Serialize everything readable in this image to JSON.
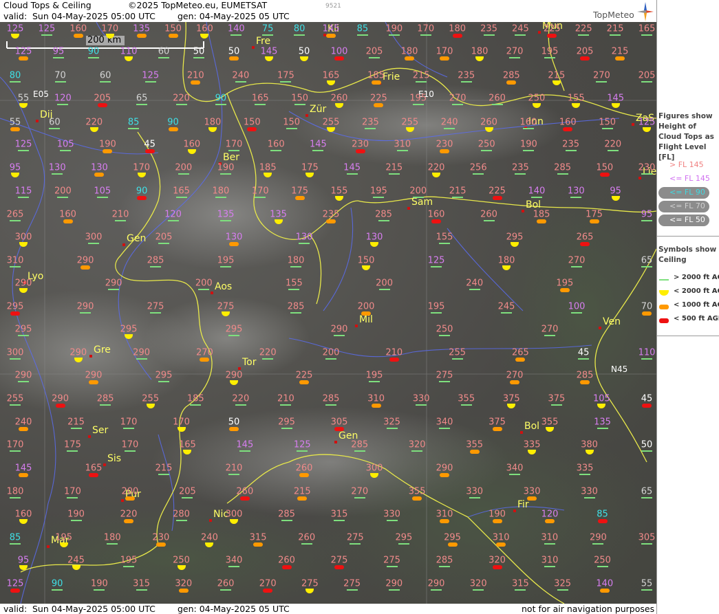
{
  "header": {
    "title": "Cloud Tops & Ceiling",
    "copyright": "©2025 TopMeteo.eu, EUMETSAT",
    "image_id": "9521",
    "valid_label": "valid:",
    "valid_time": "Sun  04-May-2025  05:00 UTC",
    "gen_time": "gen: 04-May-2025 05 UTC",
    "logo": "TopMeteo"
  },
  "footer": {
    "valid_label": "valid:",
    "valid_time": "Sun  04-May-2025  05:00 UTC",
    "gen_time": "gen: 04-May-2025 05 UTC",
    "disclaimer": "not for air navigation purposes"
  },
  "scale_bar": {
    "label": "200 km"
  },
  "legend": {
    "figures_title": "Figures show Height of Cloud Tops as Flight Level  [FL]",
    "items": [
      {
        "label": "> FL 145",
        "color": "#f08080"
      },
      {
        "label": "<= FL 145",
        "color": "#d070f0"
      },
      {
        "label": "<= FL 90",
        "color": "#40d8e0"
      },
      {
        "label": "<= FL 70",
        "color": "#cfcfcf"
      },
      {
        "label": "<= FL 50",
        "color": "#ffffff"
      }
    ],
    "symbols_title": "Symbols show Ceiling",
    "ceiling": [
      {
        "label": "> 2000 ft AGL",
        "color": "#7ee07e"
      },
      {
        "label": "< 2000 ft AGL",
        "color": "#ffee00"
      },
      {
        "label": "< 1000 ft AGL",
        "color": "#ff9900"
      },
      {
        "label": "< 500 ft AGL",
        "color": "#ee1111"
      }
    ]
  },
  "map": {
    "grid_labels": {
      "e05": "E05",
      "e10": "E10",
      "n45": "N45"
    },
    "cities": [
      {
        "name": "Fre"
      },
      {
        "name": "Kli"
      },
      {
        "name": "Mun"
      },
      {
        "name": "Dij"
      },
      {
        "name": "Zür"
      },
      {
        "name": "Inn"
      },
      {
        "name": "ZaS"
      },
      {
        "name": "Ber"
      },
      {
        "name": "Lie"
      },
      {
        "name": "Sam"
      },
      {
        "name": "Bol"
      },
      {
        "name": "Gen"
      },
      {
        "name": "Lyo"
      },
      {
        "name": "Aos"
      },
      {
        "name": "Mil"
      },
      {
        "name": "Ven"
      },
      {
        "name": "Gre"
      },
      {
        "name": "Tor"
      },
      {
        "name": "Ser"
      },
      {
        "name": "Gen"
      },
      {
        "name": "Bol"
      },
      {
        "name": "Sis"
      },
      {
        "name": "Pur"
      },
      {
        "name": "Nic"
      },
      {
        "name": "Fir"
      },
      {
        "name": "Mar"
      },
      {
        "name": "Frie"
      }
    ],
    "cloud_tops": [
      [
        125,
        125,
        160,
        170,
        135,
        150,
        160,
        140,
        75,
        80,
        145,
        85,
        190,
        170,
        180,
        235,
        245,
        225,
        225,
        215,
        165
      ],
      [
        125,
        95,
        90,
        110,
        60,
        50,
        50,
        145,
        50,
        100,
        205,
        180,
        170,
        180,
        270,
        195,
        205,
        215,
        220
      ],
      [
        80,
        70,
        60,
        125,
        210,
        240,
        175,
        165,
        185,
        215,
        235,
        285,
        215,
        270,
        205
      ],
      [
        55,
        120,
        205,
        65,
        220,
        90,
        165,
        150,
        260,
        225,
        195,
        270,
        260,
        250,
        155,
        145,
        285
      ],
      [
        55,
        60,
        220,
        85,
        90,
        180,
        150,
        150,
        255,
        235,
        255,
        240,
        260,
        160,
        160,
        150,
        125
      ],
      [
        125,
        105,
        190,
        45,
        160,
        170,
        160,
        145,
        230,
        310,
        230,
        250,
        190,
        235,
        220,
        140
      ],
      [
        95,
        130,
        130,
        170,
        200,
        190,
        185,
        175,
        145,
        215,
        220,
        256,
        235,
        285,
        150,
        230
      ],
      [
        115,
        200,
        105,
        90,
        165,
        180,
        170,
        175,
        155,
        195,
        200,
        215,
        225,
        140,
        130,
        95,
        175
      ],
      [
        265,
        160,
        210,
        120,
        135,
        135,
        235,
        285,
        160,
        260,
        185,
        175,
        95
      ],
      [
        300,
        300,
        205,
        130,
        130,
        130,
        155,
        295,
        265,
        30
      ],
      [
        310,
        290,
        285,
        195,
        180,
        150,
        125,
        180,
        270,
        65
      ],
      [
        290,
        290,
        200,
        155,
        200,
        240,
        195,
        185
      ],
      [
        295,
        290,
        275,
        275,
        285,
        200,
        195,
        245,
        100,
        70
      ],
      [
        295,
        295,
        295,
        290,
        250,
        270,
        70
      ],
      [
        300,
        290,
        290,
        270,
        220,
        200,
        210,
        255,
        265,
        45,
        110
      ],
      [
        290,
        290,
        295,
        290,
        225,
        195,
        275,
        270,
        285,
        245
      ],
      [
        255,
        290,
        285,
        255,
        185,
        220,
        210,
        285,
        310,
        330,
        355,
        375,
        375,
        105,
        45
      ],
      [
        240,
        215,
        170,
        170,
        50,
        295,
        305,
        325,
        340,
        375,
        355,
        135,
        135
      ],
      [
        170,
        175,
        170,
        165,
        145,
        125,
        285,
        320,
        355,
        335,
        380,
        50
      ],
      [
        145,
        165,
        215,
        210,
        260,
        300,
        290,
        340,
        335,
        330
      ],
      [
        180,
        170,
        200,
        205,
        260,
        215,
        270,
        355,
        330,
        330,
        330,
        65
      ],
      [
        160,
        190,
        220,
        280,
        300,
        285,
        315,
        330,
        310,
        190,
        120,
        85,
        40
      ],
      [
        85,
        195,
        180,
        230,
        240,
        315,
        260,
        275,
        295,
        295,
        310,
        310,
        290,
        305
      ],
      [
        95,
        245,
        195,
        250,
        340,
        260,
        275,
        275,
        285,
        320,
        310,
        250,
        205
      ],
      [
        125,
        90,
        190,
        315,
        320,
        260,
        270,
        275,
        275,
        290,
        290,
        320,
        315,
        325,
        140,
        55
      ]
    ]
  }
}
